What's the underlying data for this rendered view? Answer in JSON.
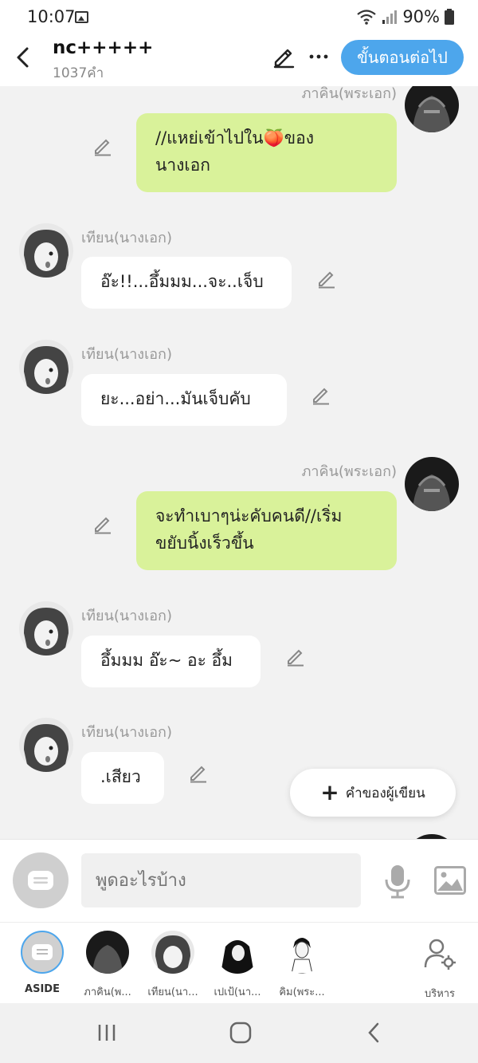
{
  "status_bar": {
    "time": "10:07",
    "battery": "90%"
  },
  "header": {
    "title": "nc+++++",
    "word_count": "1037คำ",
    "next_button": "ขั้นตอนต่อไป"
  },
  "messages": [
    {
      "speaker": "ภาคิน(พระเอก)",
      "side": "right",
      "text_line1": "//แหย่เข้าไปใน🍑ของ",
      "text_line2": "นางเอก"
    },
    {
      "speaker": "เทียน(นางเอก)",
      "side": "left",
      "text": "อ๊ะ!!...อึ้มมม...จะ..เจ็บ"
    },
    {
      "speaker": "เทียน(นางเอก)",
      "side": "left",
      "text": "ยะ...อย่า...มันเจ็บคับ"
    },
    {
      "speaker": "ภาคิน(พระเอก)",
      "side": "right",
      "text_line1": "จะทำเบาๆน่ะคับคนดี//เริ่ม",
      "text_line2": "ขยับนิ้งเร็วขึ้น"
    },
    {
      "speaker": "เทียน(นางเอก)",
      "side": "left",
      "text": "อึ้มมม อ๊ะ~ อะ อึ้ม"
    },
    {
      "speaker": "เทียน(นางเอก)",
      "side": "left",
      "text": ".เสียว"
    }
  ],
  "author_note_button": "คำของผู้เขียน",
  "input": {
    "placeholder": "พูดอะไรบ้าง"
  },
  "characters": [
    {
      "name": "ASIDE"
    },
    {
      "name": "ภาคิน(พ..."
    },
    {
      "name": "เทียน(นา..."
    },
    {
      "name": "เปเป้(นา..."
    },
    {
      "name": "คิม(พระ..."
    }
  ],
  "manage_label": "บริหาร",
  "colors": {
    "accent": "#4da6ec",
    "right_bubble": "#d9f29a",
    "left_bubble": "#ffffff"
  }
}
